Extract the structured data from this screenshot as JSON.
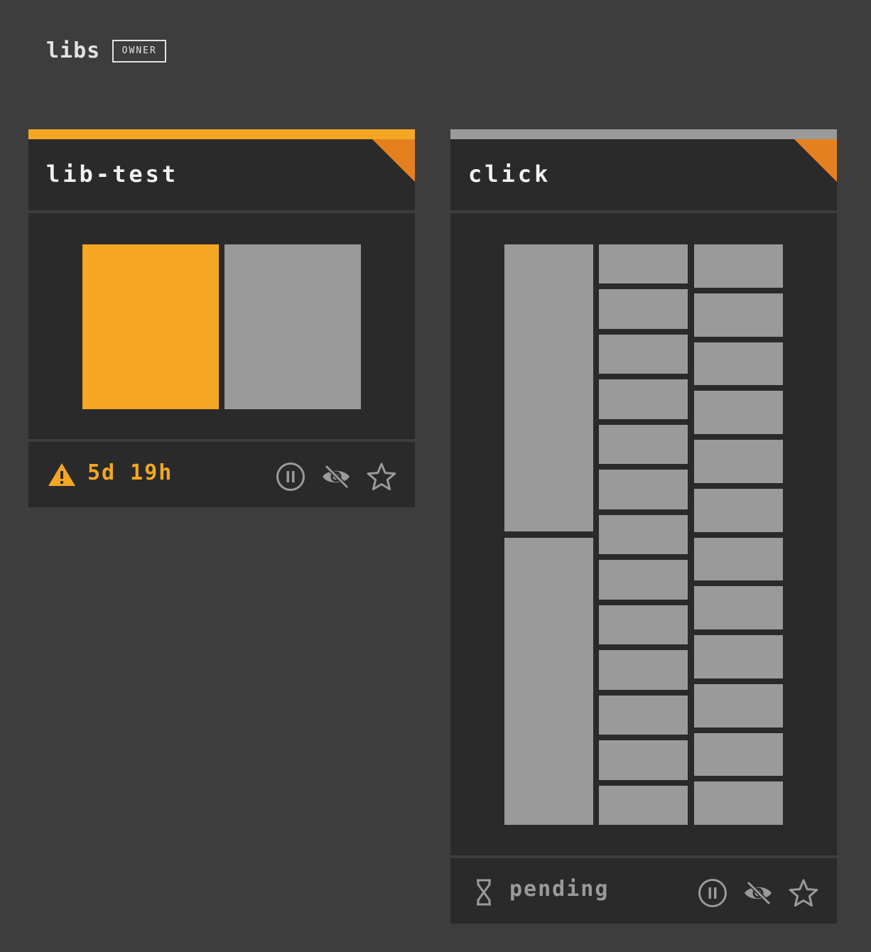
{
  "team": {
    "name": "libs",
    "role": "OWNER"
  },
  "pipelines": [
    {
      "name": "lib-test",
      "status": "failed",
      "status_text": "5d 19h",
      "status_icon": "warning-icon",
      "colors": {
        "topbar": "#f5a623",
        "corner": "#e5801f",
        "status_text": "#f5a623"
      },
      "actions": [
        "pause-icon",
        "hide-icon",
        "star-icon"
      ]
    },
    {
      "name": "click",
      "status": "pending",
      "status_text": "pending",
      "status_icon": "hourglass-icon",
      "colors": {
        "topbar": "#9a9a9a",
        "corner": "#e5801f",
        "status_text": "#9a9a9a"
      },
      "actions": [
        "pause-icon",
        "hide-icon",
        "star-icon"
      ]
    }
  ],
  "colors": {
    "background": "#3d3d3d",
    "card": "#2a2a2a",
    "failed": "#f5a623",
    "pending": "#9a9a9a",
    "icon": "#9a9a9a"
  }
}
